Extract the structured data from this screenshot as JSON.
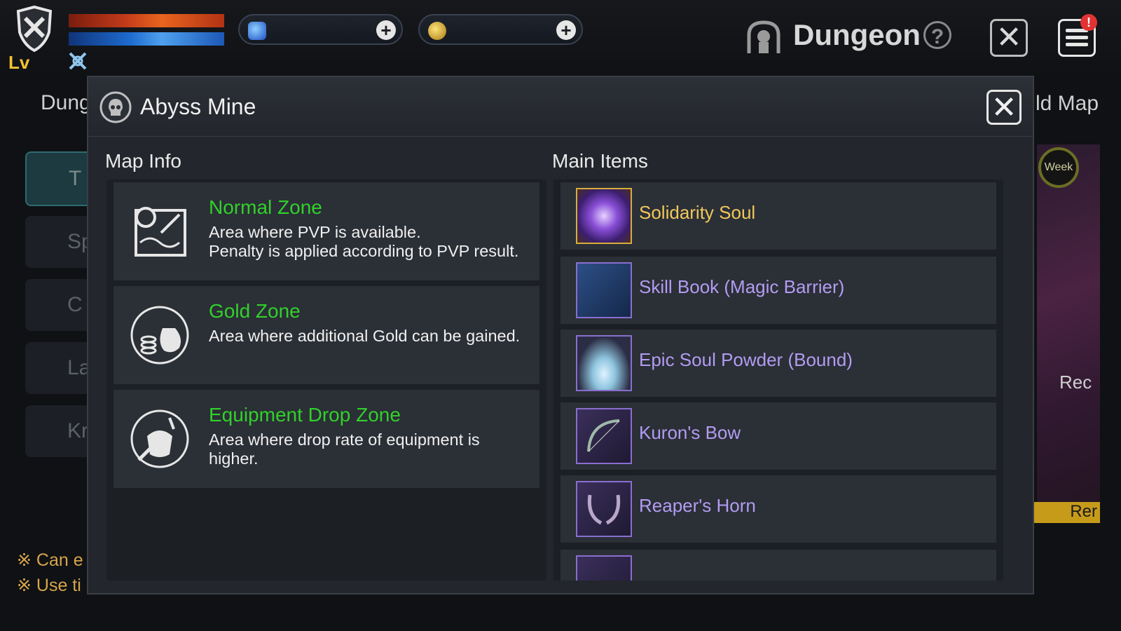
{
  "hud": {
    "level_label": "Lv",
    "screen_title": "Dungeon",
    "help_label": "?",
    "close_label": "✕",
    "notification_badge": "!",
    "currency": [
      {
        "icon": "blue-gem-icon",
        "add_label": "+"
      },
      {
        "icon": "gold-coin-icon",
        "add_label": "+"
      }
    ]
  },
  "background": {
    "tab_left": "Dung",
    "tab_right": "ld Map",
    "side_buttons": [
      "T",
      "Sp",
      "C",
      "La",
      "Kr"
    ],
    "notes": [
      "※ Can e",
      "※ Use ti"
    ],
    "week_label": "Week",
    "rec_label": "Rec",
    "ren_label": "Rer"
  },
  "modal": {
    "title": "Abyss Mine",
    "close_label": "✕",
    "map_info_title": "Map Info",
    "main_items_title": "Main Items",
    "zones": [
      {
        "name": "Normal Zone",
        "desc": "Area where PVP is available.\nPenalty is applied according to PVP result.",
        "icon": "map-pvp-icon"
      },
      {
        "name": "Gold Zone",
        "desc": "Area where additional Gold can be gained.",
        "icon": "gold-bag-icon"
      },
      {
        "name": "Equipment Drop Zone",
        "desc": "Area where drop rate of equipment is higher.",
        "icon": "equipment-icon"
      }
    ],
    "items": [
      {
        "name": "Solidarity Soul",
        "color": "#f0c85a",
        "icon": "soul-orb-icon"
      },
      {
        "name": "Skill Book (Magic Barrier)",
        "color": "#b29cf2",
        "icon": "skill-book-icon"
      },
      {
        "name": "Epic Soul Powder (Bound)",
        "color": "#b29cf2",
        "icon": "soul-powder-icon"
      },
      {
        "name": "Kuron's Bow",
        "color": "#b29cf2",
        "icon": "bow-icon"
      },
      {
        "name": "Reaper's Horn",
        "color": "#b29cf2",
        "icon": "horn-icon"
      }
    ]
  },
  "colors": {
    "zone_name": "#31d12b",
    "epic_item": "#b29cf2",
    "legendary_item": "#f0c85a",
    "level_label": "#f2c233"
  }
}
